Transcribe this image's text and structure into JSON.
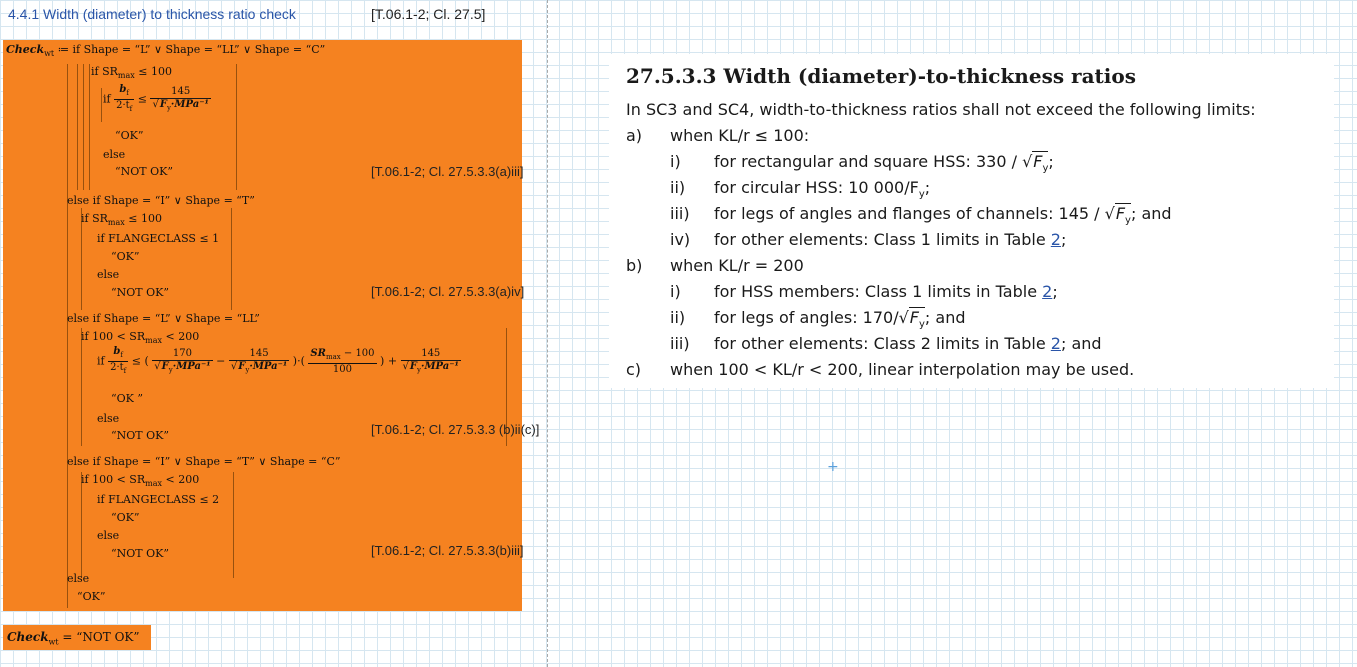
{
  "heading": {
    "title": "4.4.1 Width (diameter) to thickness ratio check",
    "reference": "[T.06.1-2; Cl. 27.5]"
  },
  "code": {
    "head": "Check",
    "head_sub": "wt",
    "c1": "if Shape = “L” ∨ Shape = “LL” ∨ Shape = “C”",
    "c2": "if SR",
    "c2_sub": "max",
    "c2_tail": "≤ 100",
    "c3_if": "if",
    "c3_num": "b",
    "c3_num_sub": "f",
    "c3_den": "2·t",
    "c3_den_sub": "f",
    "c3_cmp": "≤",
    "c3_rnum": "145",
    "c3_rden": "F",
    "c3_rden_sub": "y",
    "c3_rden_tail": "·MPa⁻¹",
    "ok1": "“OK”",
    "else1": "else",
    "nok1": "“NOT OK”",
    "ref1": "[T.06.1-2; Cl. 27.5.3.3(a)iii]",
    "c4": "else if Shape = “I” ∨ Shape = “T”",
    "c5": "if SR",
    "c5_sub": "max",
    "c5_tail": "≤ 100",
    "c6": "if FLANGECLASS ≤ 1",
    "ok2": "“OK”",
    "else2": "else",
    "nok2": "“NOT OK”",
    "ref2": "[T.06.1-2; Cl. 27.5.3.3(a)iv]",
    "c7": "else if Shape = “L” ∨ Shape = “LL”",
    "c8": "if 100 < SR",
    "c8_sub": "max",
    "c8_tail": "< 200",
    "c9_if": "if",
    "c9_n1": "170",
    "c9_n2": "145",
    "c9_n3": "SR",
    "c9_n3_sub": "max",
    "c9_n3_tail": " − 100",
    "c9_d3": "100",
    "c9_n4": "145",
    "ok3": "“OK ”",
    "else3": "else",
    "nok3": "“NOT OK”",
    "ref3": "[T.06.1-2; Cl. 27.5.3.3 (b)ii(c)]",
    "c10": "else if Shape = “I” ∨ Shape = “T” ∨ Shape = “C”",
    "c11": "if 100 < SR",
    "c11_sub": "max",
    "c11_tail": "< 200",
    "c12": "if FLANGECLASS ≤ 2",
    "ok4": "“OK”",
    "else4": "else",
    "nok4": "“NOT OK”",
    "ref4": "[T.06.1-2; Cl. 27.5.3.3(b)iii]",
    "else_final": "else",
    "ok_final": "“OK”"
  },
  "result": {
    "label": "Check",
    "label_sub": "wt",
    "value": "= “NOT OK”"
  },
  "doc": {
    "title": "27.5.3.3 Width (diameter)-to-thickness ratios",
    "intro": "In SC3 and SC4, width-to-thickness ratios shall not exceed the following limits:",
    "a_label": "a)",
    "a_text": "when KL/r ≤ 100:",
    "a1_label": "i)",
    "a1_text": "for rectangular and square HSS: 330 /",
    "a1_end": ";",
    "a2_label": "ii)",
    "a2_text": "for circular HSS: 10 000/F",
    "a2_end": ";",
    "a3_label": "iii)",
    "a3_text": "for legs of angles and flanges of channels: 145 /",
    "a3_end": "; and",
    "a4_label": "iv)",
    "a4_text": "for other elements: Class 1 limits in Table",
    "a4_link": "2",
    "a4_end": ";",
    "b_label": "b)",
    "b_text": "when KL/r = 200",
    "b1_label": "i)",
    "b1_text": "for HSS members: Class 1 limits in Table",
    "b1_link": "2",
    "b1_end": ";",
    "b2_label": "ii)",
    "b2_text": "for legs of angles: 170/",
    "b2_end": "; and",
    "b3_label": "iii)",
    "b3_text": "for other elements: Class 2 limits in Table",
    "b3_link": "2",
    "b3_end": "; and",
    "c_label": "c)",
    "c_text": "when 100 < KL/r < 200, linear interpolation may be used.",
    "fy": "F",
    "fy_sub": "y"
  },
  "colors": {
    "highlight": "#f58220",
    "heading": "#2a55a8",
    "grid": "#d6e6f0"
  }
}
